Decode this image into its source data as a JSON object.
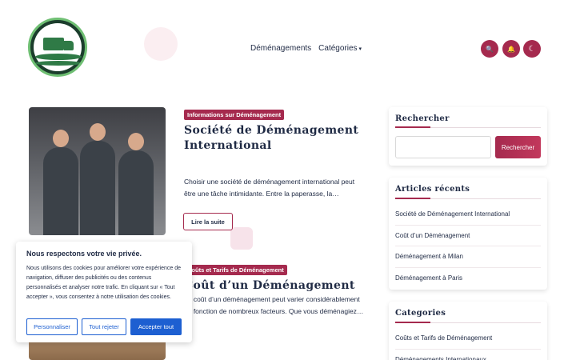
{
  "header": {
    "nav": [
      {
        "label": "Déménagements"
      },
      {
        "label": "Catégories",
        "caret": "▾"
      }
    ],
    "buttons": {
      "search_icon": "🔍",
      "bell_icon": "🔔",
      "moon_icon": "☾"
    }
  },
  "posts": [
    {
      "category": "Informations sur Déménagement",
      "title_line1": "Société de Déménagement",
      "title_line2": "International",
      "excerpt": "Choisir une société de déménagement international peut être une tâche intimidante. Entre la paperasse, la…",
      "read_more": "Lire la suite"
    },
    {
      "category": "Coûts et Tarifs de Déménagement",
      "title": "Coût d’un Déménagement",
      "excerpt": "Le coût d’un déménagement peut varier considérablement en fonction de nombreux facteurs. Que vous déménagiez…"
    }
  ],
  "sidebar": {
    "search": {
      "title": "Rechercher",
      "button": "Rechercher",
      "placeholder": ""
    },
    "recent": {
      "title": "Articles récents",
      "items": [
        "Société de Déménagement International",
        "Coût d’un Déménagement",
        "Déménagement à Milan",
        "Déménagement à Paris"
      ]
    },
    "categories": {
      "title": "Categories",
      "items": [
        "Coûts et Tarifs de Déménagement",
        "Déménagements Internationaux"
      ]
    }
  },
  "cookie": {
    "title": "Nous respectons votre vie privée.",
    "text": "Nous utilisons des cookies pour améliorer votre expérience de navigation, diffuser des publicités ou des contenus personnalisés et analyser notre trafic. En cliquant sur « Tout accepter », vous consentez à notre utilisation des cookies.",
    "customize": "Personnaliser",
    "reject": "Tout rejeter",
    "accept": "Accepter tout"
  },
  "colors": {
    "accent": "#a52a4e",
    "cookie_blue": "#1d5fd1",
    "text": "#1f2a44"
  }
}
